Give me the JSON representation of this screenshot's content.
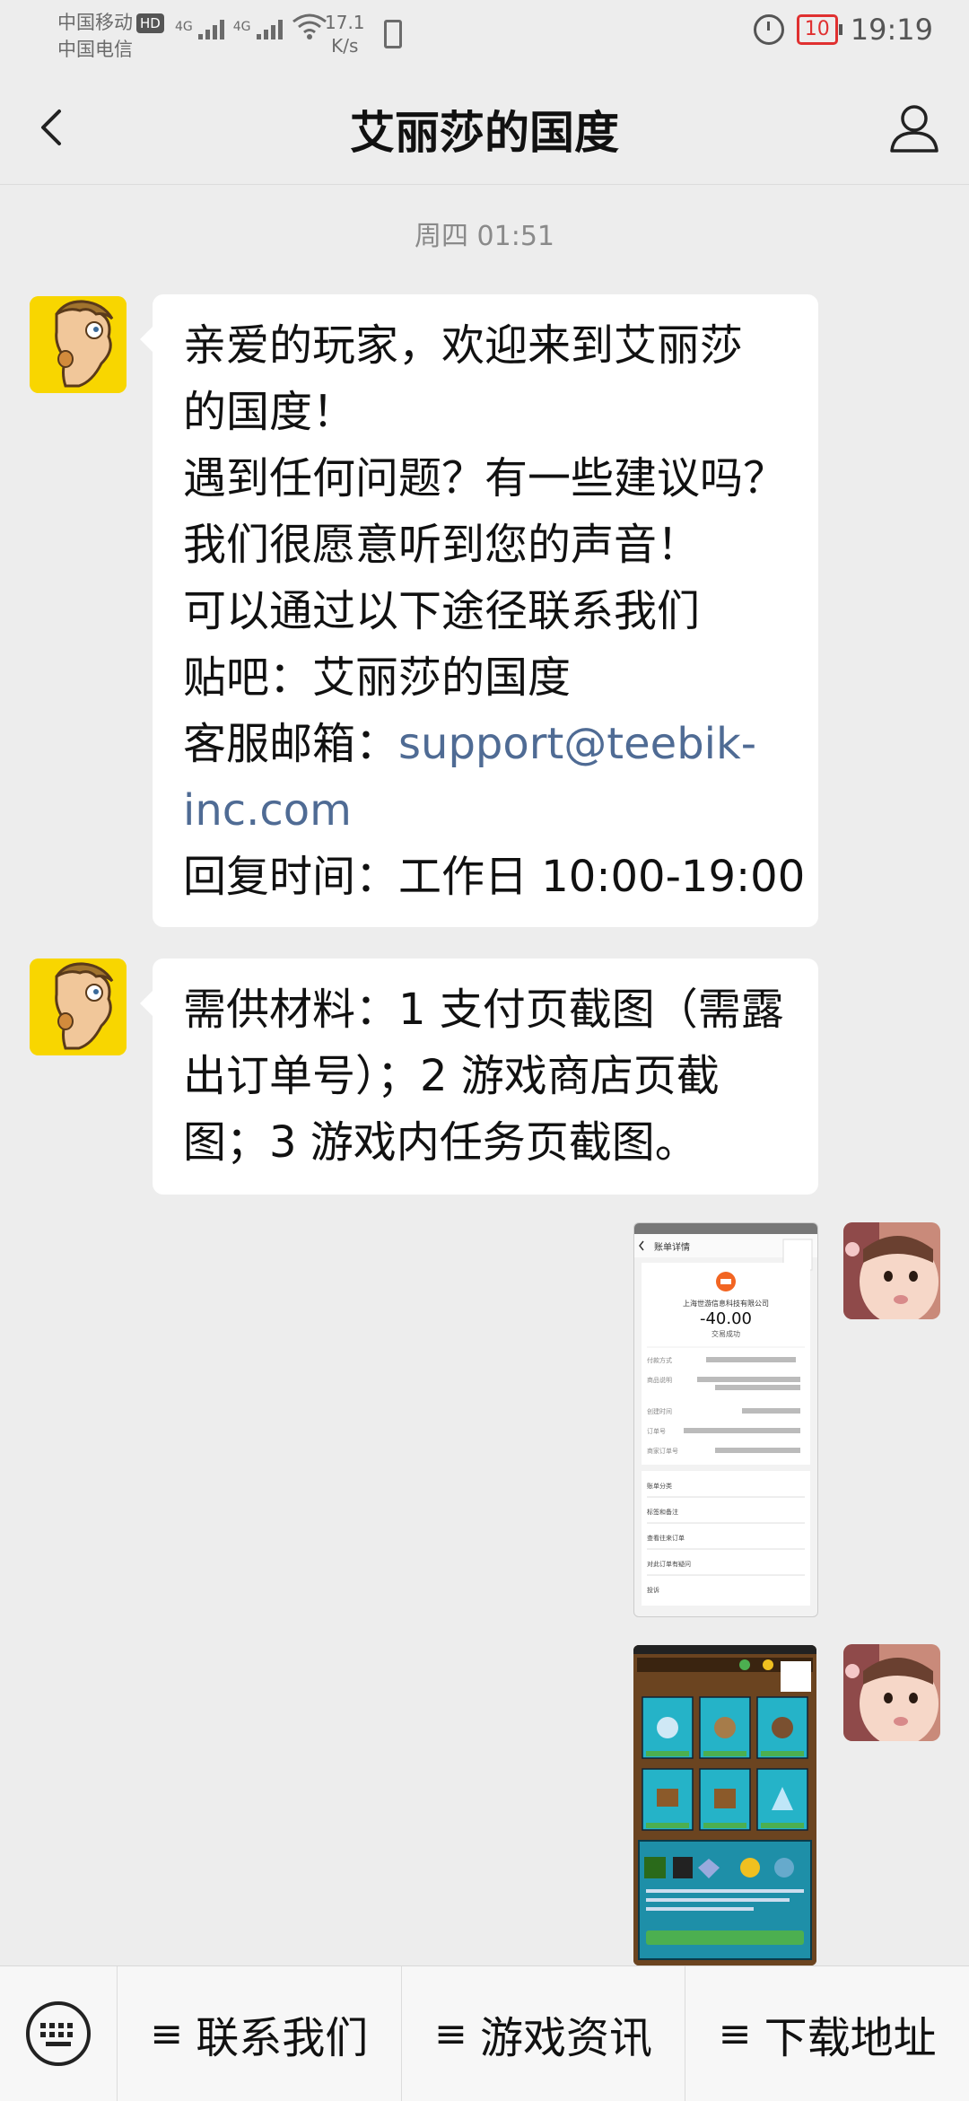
{
  "status": {
    "carrier1": "中国移动",
    "hd": "HD",
    "carrier2": "中国电信",
    "net1": "4G",
    "net2": "4G",
    "speed_value": "17.1",
    "speed_unit": "K/s",
    "battery": "10",
    "time": "19:19"
  },
  "nav": {
    "title": "艾丽莎的国度"
  },
  "chat": {
    "timestamp": "周四 01:51",
    "message1": {
      "l1": "亲爱的玩家，欢迎来到艾丽莎",
      "l2": "的国度！",
      "l3": "遇到任何问题？有一些建议吗？",
      "l4": "我们很愿意听到您的声音！",
      "l5": "可以通过以下途径联系我们",
      "l6": "贴吧：艾丽莎的国度",
      "l7_label": "客服邮箱：",
      "l7_link": "support@teebik-",
      "l8_link": "inc.com",
      "l9": "回复时间：工作日 10:00-19:00"
    },
    "message2": {
      "l1": "需供材料：1 支付页截图（需露",
      "l2": "出订单号）；2 游戏商店页截",
      "l3": "图；3 游戏内任务页截图。"
    },
    "receipt_image": {
      "title": "账单详情",
      "merchant": "上海世游信息科技有限公司",
      "amount": "-40.00",
      "status": "交易成功",
      "rows": [
        "付款方式",
        "商品说明",
        "创建时间",
        "订单号",
        "商家订单号"
      ],
      "links": [
        "账单分类",
        "标签和备注",
        "查看往来订单",
        "对此订单有疑问",
        "投诉"
      ]
    }
  },
  "bottom_menu": {
    "item1": "联系我们",
    "item2": "游戏资讯",
    "item3": "下载地址"
  }
}
